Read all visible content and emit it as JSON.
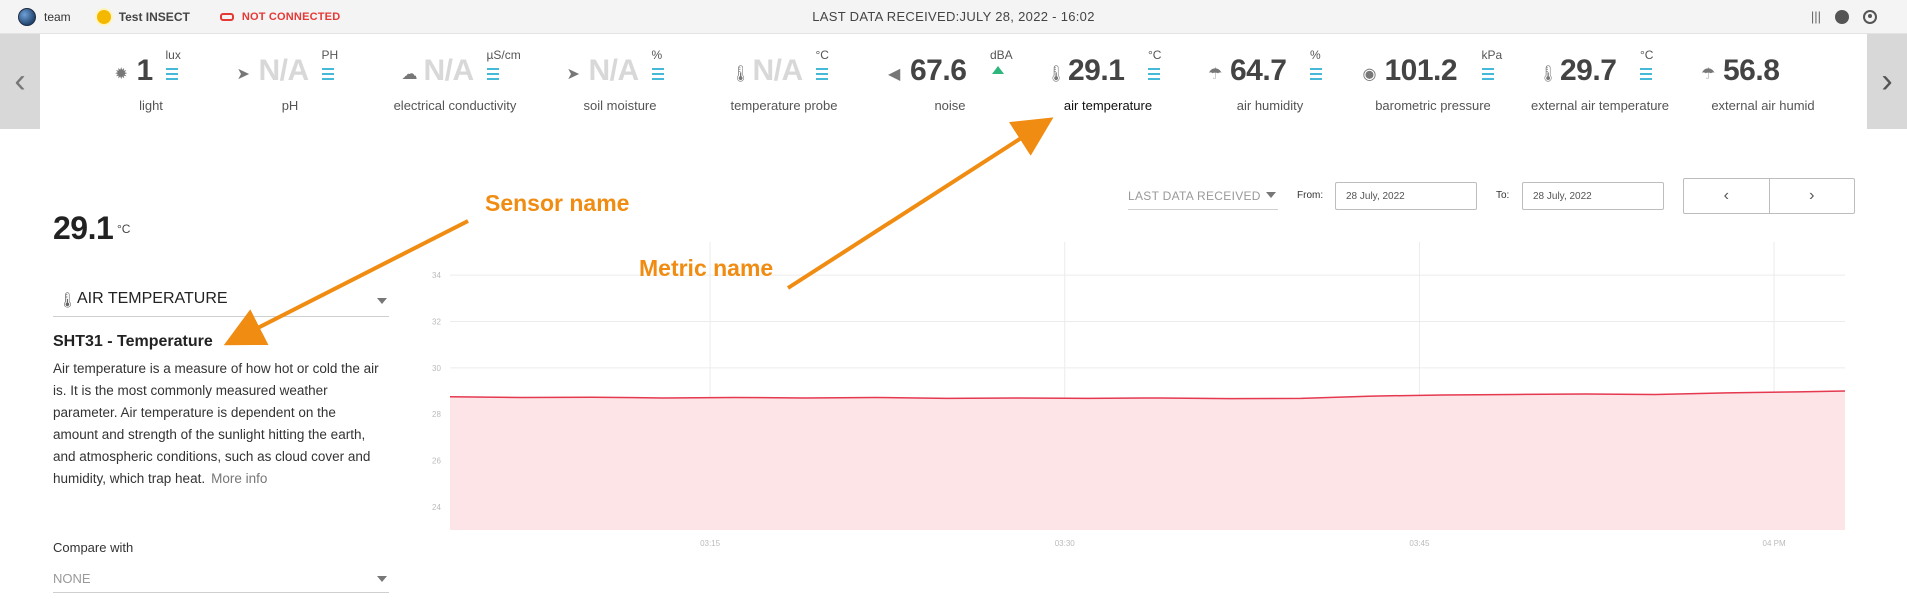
{
  "topbar": {
    "team": "team",
    "device": "Test INSECT",
    "connection": "NOT CONNECTED",
    "last_received": "LAST DATA RECEIVED:JULY 28, 2022 - 16:02"
  },
  "metrics": [
    {
      "label": "light",
      "value": "1",
      "unit": "lux",
      "icon": "sun-gear-icon",
      "na": false
    },
    {
      "label": "pH",
      "value": "N/A",
      "unit": "PH",
      "icon": "drop-icon",
      "na": true
    },
    {
      "label": "electrical conductivity",
      "value": "N/A",
      "unit": "µS/cm",
      "icon": "cloud-icon",
      "na": true
    },
    {
      "label": "soil moisture",
      "value": "N/A",
      "unit": "%",
      "icon": "drop-icon",
      "na": true
    },
    {
      "label": "temperature probe",
      "value": "N/A",
      "unit": "°C",
      "icon": "thermometer-icon",
      "na": true
    },
    {
      "label": "noise",
      "value": "67.6",
      "unit": "dBA",
      "icon": "speaker-icon",
      "na": false
    },
    {
      "label": "air temperature",
      "value": "29.1",
      "unit": "°C",
      "icon": "thermometer-icon",
      "na": false,
      "active": true
    },
    {
      "label": "air humidity",
      "value": "64.7",
      "unit": "%",
      "icon": "rain-cloud-icon",
      "na": false
    },
    {
      "label": "barometric pressure",
      "value": "101.2",
      "unit": "kPa",
      "icon": "gauge-icon",
      "na": false
    },
    {
      "label": "external air temperature",
      "value": "29.7",
      "unit": "°C",
      "icon": "thermometer-icon",
      "na": false
    },
    {
      "label": "external air humid",
      "value": "56.8",
      "unit": "",
      "icon": "rain-cloud-icon",
      "na": false
    }
  ],
  "detail": {
    "value": "29.1",
    "unit": "°C",
    "metric_select": "AIR TEMPERATURE",
    "sensor_name": "SHT31 - Temperature",
    "description": "Air temperature is a measure of how hot or cold the air is. It is the most commonly measured weather parameter. Air temperature is dependent on the amount and strength of the sunlight hitting the earth, and atmospheric conditions, such as cloud cover and humidity, which trap heat.",
    "more_info": "More info",
    "compare_label": "Compare with",
    "compare_value": "NONE"
  },
  "controls": {
    "range": "LAST DATA RECEIVED",
    "from_label": "From:",
    "from_date": "28 July, 2022",
    "to_label": "To:",
    "to_date": "28 July, 2022",
    "prev": "‹",
    "next": "›"
  },
  "annotations": {
    "sensor": "Sensor name",
    "metric": "Metric name"
  },
  "chart_data": {
    "type": "area",
    "ylim": [
      23,
      35
    ],
    "y_ticks": [
      24,
      26,
      28,
      30,
      32,
      34
    ],
    "x_ticks": [
      "03:15",
      "03:30",
      "03:45",
      "04 PM"
    ],
    "x_tick_minutes": [
      15,
      30,
      45,
      60
    ],
    "xlim": [
      4,
      63
    ],
    "color": "#e53950",
    "fill": "#fde4e7",
    "points": [
      [
        4,
        28.75
      ],
      [
        7,
        28.72
      ],
      [
        10,
        28.73
      ],
      [
        13,
        28.7
      ],
      [
        16,
        28.72
      ],
      [
        19,
        28.7
      ],
      [
        22,
        28.72
      ],
      [
        25,
        28.68
      ],
      [
        28,
        28.7
      ],
      [
        31,
        28.68
      ],
      [
        34,
        28.7
      ],
      [
        37,
        28.67
      ],
      [
        40,
        28.68
      ],
      [
        43,
        28.78
      ],
      [
        46,
        28.83
      ],
      [
        49,
        28.85
      ],
      [
        52,
        28.87
      ],
      [
        55,
        28.85
      ],
      [
        58,
        28.92
      ],
      [
        61,
        28.96
      ],
      [
        63,
        29.0
      ]
    ]
  }
}
